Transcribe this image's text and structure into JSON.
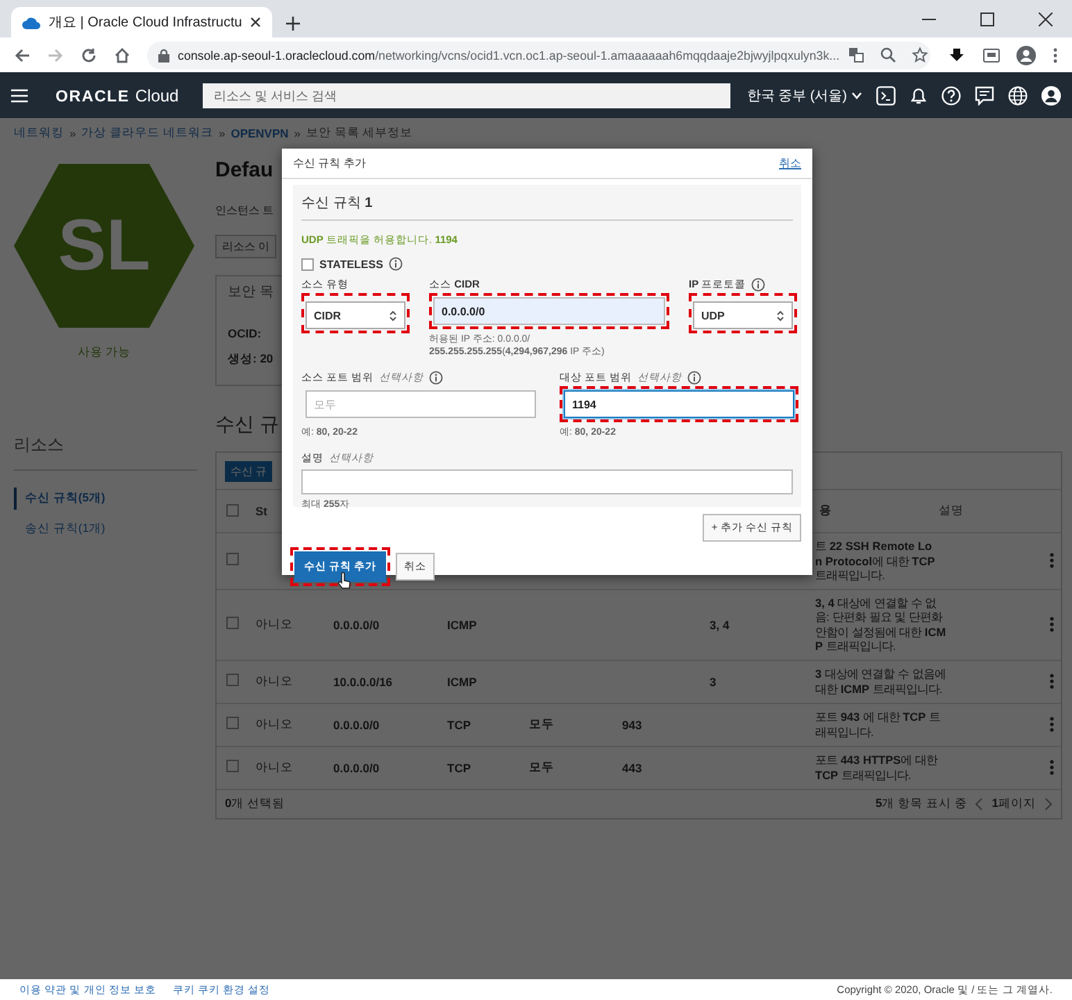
{
  "browser": {
    "tab_title": "개요 | Oracle Cloud Infrastructu",
    "url_host": "console.ap-seoul-1.oraclecloud.com",
    "url_path": "/networking/vcns/ocid1.vcn.oc1.ap-seoul-1.amaaaaaah6mqqdaaje2bjwyjlpqxulyn3k..."
  },
  "header": {
    "brand": "ORACLE",
    "product": "Cloud",
    "search": {
      "placeholder": "리소스 및 서비스 검색"
    },
    "region": "한국 중부 (서울)"
  },
  "breadcrumb": {
    "separator": "»",
    "items": [
      {
        "label": "네트워킹",
        "kind": "link"
      },
      {
        "label": "가상 클라우드 네트워크",
        "kind": "link"
      },
      {
        "label": "OPENVPN",
        "kind": "strong"
      },
      {
        "label": "보안 목록 세부정보",
        "kind": "plain"
      }
    ]
  },
  "resource": {
    "initials": "SL",
    "state": "사용 가능"
  },
  "resources_nav": {
    "title": "리소스",
    "items": [
      {
        "label": "수신 규칙(5개)",
        "selected": true
      },
      {
        "label": "송신 규칙(1개)",
        "selected": false
      }
    ]
  },
  "details": {
    "title": "Defau",
    "subtitle": "인스턴스 트",
    "action_button": "리소스 이",
    "info_title": "보안 목",
    "fields": [
      "OCID:",
      "생성: 20"
    ]
  },
  "rules": {
    "title": "수신 규",
    "add_button": "수신 규",
    "header_checked": false,
    "headers": {
      "stateless": "St",
      "allows": "용",
      "description": "설명"
    },
    "rows": [
      {
        "checked": false,
        "allows": [
          "트 **22 SSH Remote Lo**",
          "**n Protocol**에 대한 **TCP**",
          "트래픽입니다."
        ]
      },
      {
        "checked": false,
        "stateless": "아니오",
        "source": "0.0.0.0/0",
        "protocol": "ICMP",
        "type_code": "3, 4",
        "allows": [
          "**3, 4** 대상에 연결할 수 없",
          "음: 단편화 필요 및 단편화",
          "안함이 설정됨에 대한 **ICM**",
          "**P** 트래픽입니다."
        ]
      },
      {
        "checked": false,
        "stateless": "아니오",
        "source": "10.0.0.0/16",
        "protocol": "ICMP",
        "type_code": "3",
        "allows": [
          "**3** 대상에 연결할 수 없음에",
          "대한 **ICMP** 트래픽입니다."
        ]
      },
      {
        "checked": false,
        "stateless": "아니오",
        "source": "0.0.0.0/0",
        "protocol": "TCP",
        "source_port": "모두",
        "dest_port": "943",
        "allows": [
          "포트 **943** 에 대한 **TCP** 트",
          "래픽입니다."
        ]
      },
      {
        "checked": false,
        "stateless": "아니오",
        "source": "0.0.0.0/0",
        "protocol": "TCP",
        "source_port": "모두",
        "dest_port": "443",
        "allows": [
          "포트 **443 HTTPS**에 대한",
          "**TCP** 트래픽입니다."
        ]
      }
    ],
    "selected_count": "**0**개 선택됨",
    "showing": "**5**개 항목 표시 중",
    "page": "**1**페이지"
  },
  "dialog": {
    "title": "수신 규칙 추가",
    "cancel_link": "취소",
    "rule_title": "수신 규칙 **1**",
    "summary": "**UDP** 트래픽을 허용합니다. **1194**",
    "stateless": {
      "label": "STATELESS",
      "checked": false
    },
    "source_type": {
      "label": "소스 유형",
      "value": "CIDR",
      "highlighted": true
    },
    "source_cidr": {
      "label": "소스 **CIDR**",
      "value": "0.0.0.0/0",
      "highlighted": true,
      "hint": [
        "허용된 IP 주소: 0.0.0.0/",
        "**255.255.255.255**(**4,294,967,296** IP 주소)"
      ]
    },
    "protocol": {
      "label": "**IP** 프로토콜",
      "value": "UDP",
      "highlighted": true
    },
    "source_port": {
      "label": "소스 포트 범위",
      "optional": "선택사항",
      "placeholder": "모두",
      "focused": false,
      "highlighted": false,
      "hint": "예: **80, 20-22**"
    },
    "dest_port": {
      "label": "대상 포트 범위",
      "optional": "선택사항",
      "value": "1194",
      "focused": true,
      "highlighted": true,
      "hint": "예: **80, 20-22**"
    },
    "description": {
      "label": "설명",
      "optional": "선택사항",
      "hint": "최대 **255**자"
    },
    "add_rule_button": "+ 추가 수신 규칙",
    "submit_button": {
      "label": "수신 규칙 추가",
      "highlighted": true
    },
    "cancel_button": "취소"
  },
  "footer": {
    "links": [
      "이용 약관 및 개인 정보 보호",
      "쿠키 쿠키 환경 설정"
    ],
    "copyright": "Copyright © 2020, Oracle 및 / 또는 그 계열사."
  }
}
